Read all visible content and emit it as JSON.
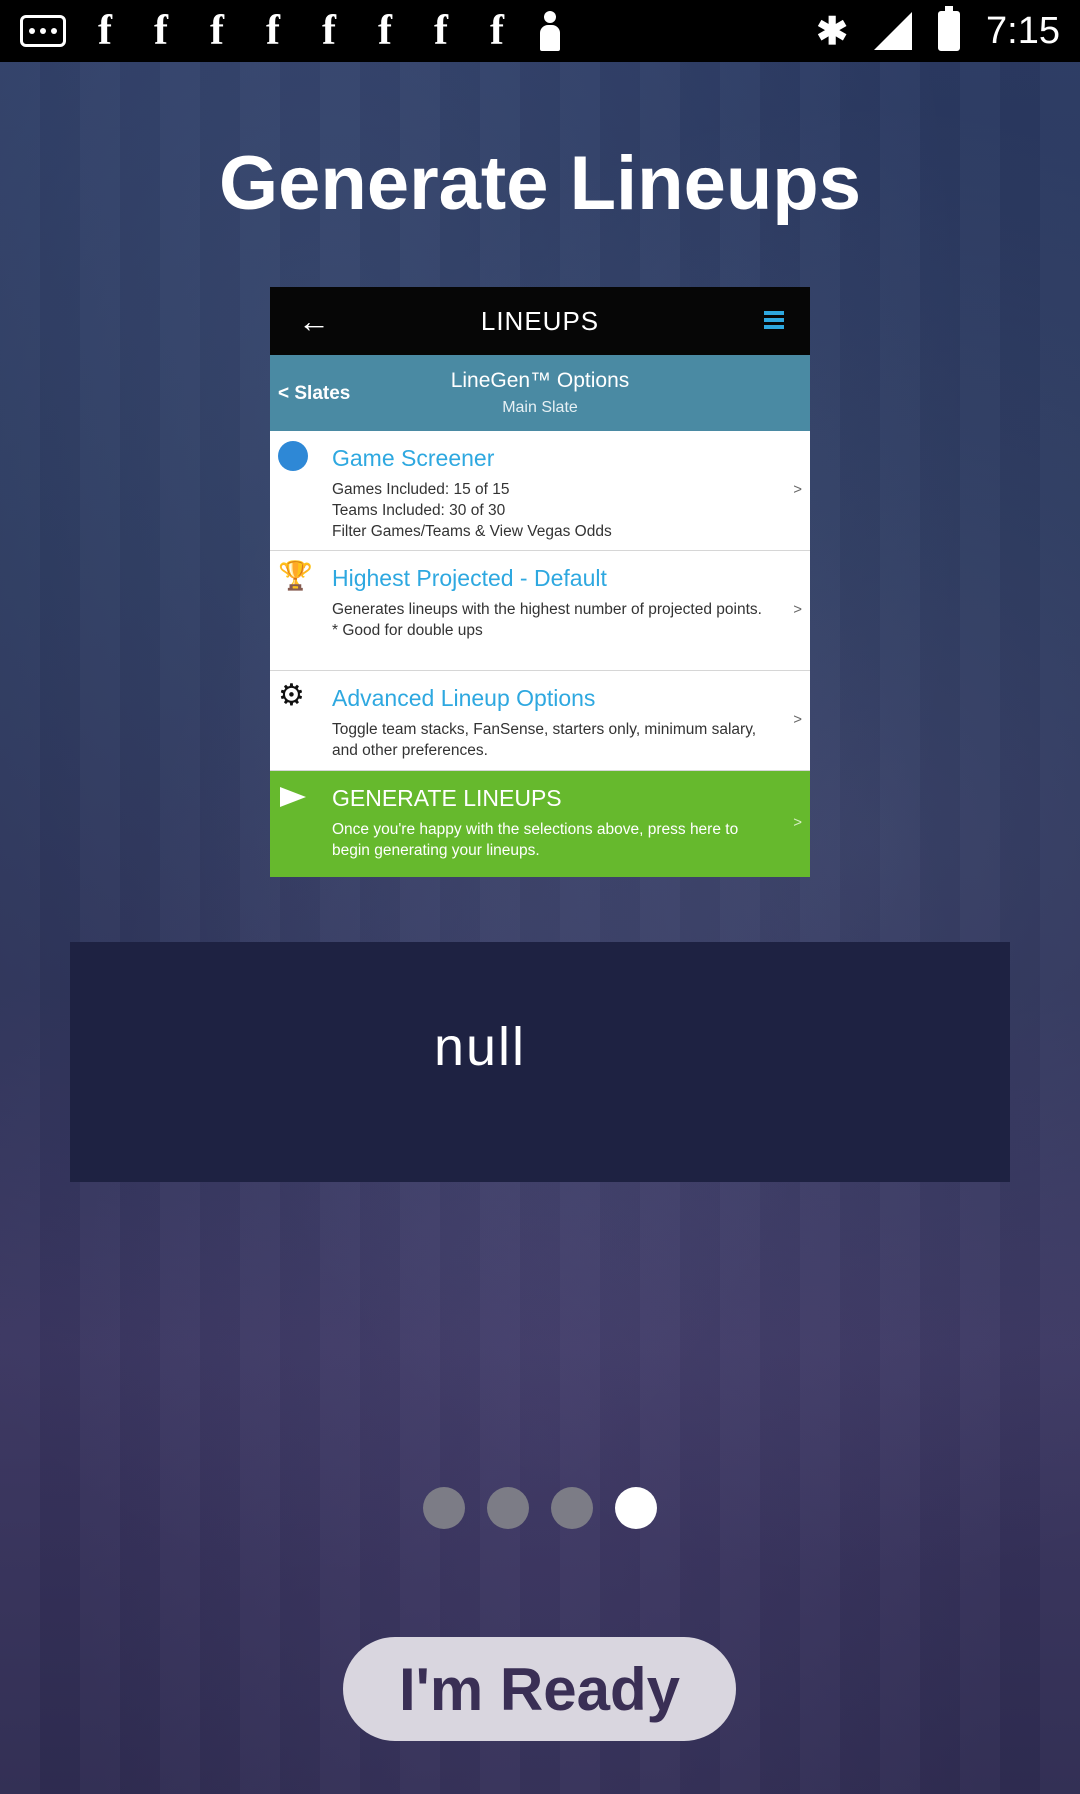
{
  "status_bar": {
    "time": "7:15",
    "notification_icons": [
      "message-icon",
      "f-icon",
      "f-icon",
      "f-icon",
      "f-icon",
      "f-icon",
      "f-icon",
      "f-icon",
      "f-icon",
      "person-icon"
    ],
    "f_glyph": "f"
  },
  "title": "Generate Lineups",
  "preview": {
    "header_title": "LINEUPS",
    "back_glyph": "←",
    "slates_link": "< Slates",
    "options_title": "LineGen™ Options",
    "slate_name": "Main Slate",
    "rows": [
      {
        "title": "Game Screener",
        "lines": [
          "Games Included: 15 of 15",
          "Teams Included: 30 of 30",
          "Filter Games/Teams & View Vegas Odds"
        ],
        "icon": "baseball-icon"
      },
      {
        "title": "Highest Projected - Default",
        "lines": [
          "Generates lineups with the highest number of projected points.",
          "* Good for double ups"
        ],
        "icon": "trophy-icon"
      },
      {
        "title": "Advanced Lineup Options",
        "lines": [
          "Toggle team stacks, FanSense, starters only, minimum salary, and other preferences."
        ],
        "icon": "gear-icon"
      },
      {
        "title": "GENERATE LINEUPS",
        "lines": [
          "Once you're happy with the selections above, press here to begin generating your lineups."
        ],
        "icon": "send-icon"
      }
    ],
    "chevron": ">"
  },
  "description": "null",
  "pager": {
    "count": 4,
    "active_index": 3
  },
  "ready_button": "I'm Ready",
  "colors": {
    "accent_blue": "#2ea8e0",
    "subheader": "#4a8aa3",
    "generate_green": "#66b92d",
    "button_bg": "#d9d6df",
    "button_text": "#3a2f55"
  }
}
